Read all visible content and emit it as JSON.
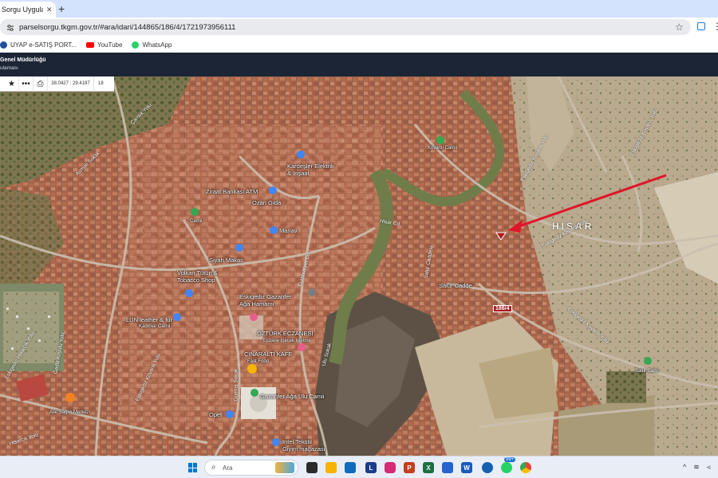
{
  "browser": {
    "tab_title": "Sorgu Uygulamas",
    "tab_close": "✕",
    "new_tab": "+",
    "url": "parselsorgu.tkgm.gov.tr/#ara/idari/144865/186/4/1721973956111",
    "bookmarks": [
      {
        "label": "UYAP e-SATIŞ PORT...",
        "icon": "uyap-icon"
      },
      {
        "label": "YouTube",
        "icon": "youtube-icon"
      },
      {
        "label": "WhatsApp",
        "icon": "whatsapp-icon"
      }
    ]
  },
  "app": {
    "org": "Genel Müdürlüğü",
    "subtitle": "ulaması"
  },
  "map_toolbar": {
    "coords": "38.0427 : 29.4187",
    "zoom": "18"
  },
  "map": {
    "area_label": "HISAR",
    "parcel_label": "186/4",
    "pois": {
      "kovanli": "Kovanlı Camii",
      "kardesler": "Kardeşler Elektrik\n& Inşaat",
      "ziraat": "Ziraat Bankası ATM",
      "ozan": "Ozan Gıda",
      "cami": "Camii",
      "manav": "Manav",
      "siyah": "Siyah Makas",
      "volkan": "Volkan Tütün &\nTobacco Shop",
      "hamam": "Eskigediz Gazanfer\nAğa Hamamı",
      "leather": "LUN leather & fur",
      "kadinlar": "Kadınlar Camii",
      "ozturk": "ÖZTÜRK ECZANESİ",
      "ozturk_sub": "Eczane İçecek işletme",
      "cinaralti": "ÇINARALTI KAFE",
      "fastfood": "Fast Food",
      "gazanfer": "Gazanfer Ağa Ulu Camii",
      "opet": "Opet",
      "aile": "Aile Sağlık Merkezi",
      "intel": "Intel Tekstil\nGiyim mağazası",
      "salur_cami": "Salur Cami",
      "salur_cadde": "Salur Cadde"
    },
    "streets": {
      "s1": "Eskigediz Kovanlı Yolu",
      "s2": "Eskigediz Kovanlı Yolu",
      "s3": "Eskigediz Kovanlı Yolu",
      "s4": "Eskigediz Kovanlı Yolu",
      "s5": "Eskigediz Kovanlı Yolu",
      "s6": "Eskigediz Hisarcık Yolu",
      "s7": "Gümüş Sokak",
      "s8": "Asmalı Sokak",
      "s9": "Cumhuriyet Cd.",
      "s10": "Ulu Sokak",
      "s11": "Salur Caddesi",
      "s12": "Gediz Koyulu Yolu",
      "s13": "Hisar Cd.",
      "s14": "Hisarcık Yolu",
      "s15": "Çamlık Yolu"
    },
    "arrow_color": "#e0142a"
  },
  "taskbar": {
    "search_placeholder": "Ara",
    "badge": "99+",
    "apps": [
      {
        "name": "task-view",
        "color": "#222"
      },
      {
        "name": "file-explorer",
        "color": "#f5b400"
      },
      {
        "name": "store",
        "color": "#0f6cbd"
      },
      {
        "name": "lexpera",
        "color": "#1b3c8c"
      },
      {
        "name": "instagram",
        "color": "#d62976"
      },
      {
        "name": "powerpoint",
        "color": "#c43e1c"
      },
      {
        "name": "excel",
        "color": "#1d6f42"
      },
      {
        "name": "todo",
        "color": "#2564cf"
      },
      {
        "name": "word",
        "color": "#185abd"
      },
      {
        "name": "gov-app",
        "color": "#1760b0"
      },
      {
        "name": "whatsapp",
        "color": "#25d366"
      },
      {
        "name": "chrome",
        "color": "#ea4335"
      }
    ],
    "app_letters": {
      "lexpera": "L",
      "word": "W",
      "powerpoint": "P",
      "excel": "X"
    }
  }
}
